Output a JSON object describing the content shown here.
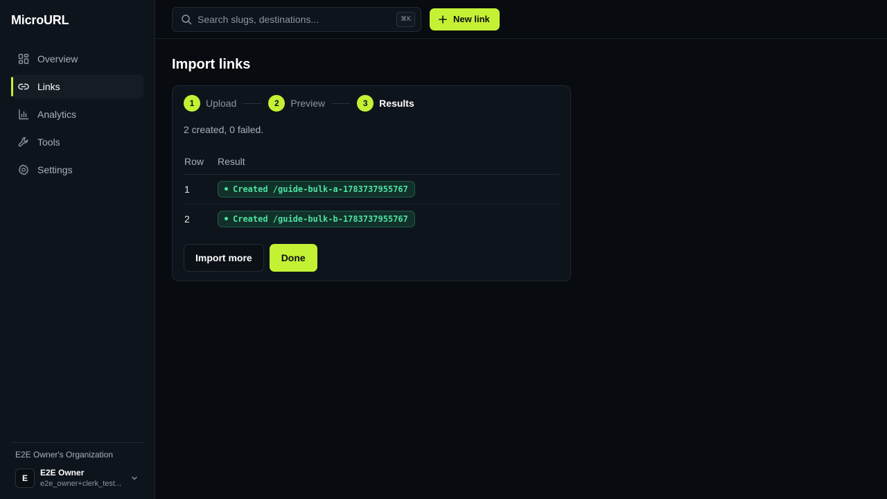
{
  "sidebar": {
    "brand": "MicroURL",
    "items": [
      {
        "label": "Overview",
        "icon": "grid-icon",
        "active": false
      },
      {
        "label": "Links",
        "icon": "link-icon",
        "active": true
      },
      {
        "label": "Analytics",
        "icon": "bar-chart-icon",
        "active": false
      },
      {
        "label": "Tools",
        "icon": "wrench-icon",
        "active": false
      },
      {
        "label": "Settings",
        "icon": "gear-icon",
        "active": false
      }
    ],
    "org_name": "E2E Owner's Organization",
    "user": {
      "initial": "E",
      "name": "E2E Owner",
      "email": "e2e_owner+clerk_test..."
    }
  },
  "topbar": {
    "search_placeholder": "Search slugs, destinations...",
    "search_value": "",
    "shortcut": "⌘K",
    "new_link_label": "New link"
  },
  "page": {
    "title": "Import links",
    "steps": [
      {
        "number": "1",
        "label": "Upload",
        "current": false
      },
      {
        "number": "2",
        "label": "Preview",
        "current": false
      },
      {
        "number": "3",
        "label": "Results",
        "current": true
      }
    ],
    "summary": "2 created, 0 failed.",
    "table": {
      "headers": [
        "Row",
        "Result"
      ],
      "rows": [
        {
          "row": "1",
          "result": "Created /guide-bulk-a-1783737955767"
        },
        {
          "row": "2",
          "result": "Created /guide-bulk-b-1783737955767"
        }
      ]
    },
    "import_more_label": "Import more",
    "done_label": "Done"
  },
  "colors": {
    "accent": "#c5f135",
    "background": "#080b10",
    "sidebar": "#0e141b",
    "success_text": "#4be3a2",
    "success_bg": "#12302a"
  }
}
